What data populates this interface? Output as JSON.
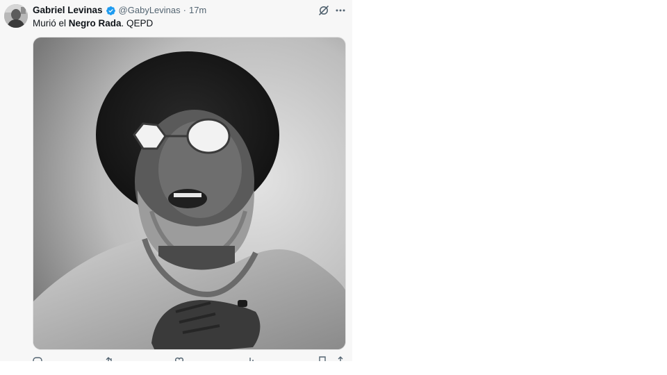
{
  "tweet": {
    "author": {
      "display_name": "Gabriel Levinas",
      "handle": "@GabyLevinas",
      "verified": true
    },
    "separator": "·",
    "time_ago": "17m",
    "text_parts": {
      "before": "Murió el ",
      "bold": "Negro Rada",
      "after": ". QEPD"
    },
    "media": {
      "type": "photo",
      "style": "black-and-white portrait"
    }
  },
  "icons": {
    "verified": "verified-badge-icon",
    "grok": "grok-icon",
    "more": "more-options-icon",
    "reply": "reply-icon",
    "repost": "repost-icon",
    "like": "like-icon",
    "views": "views-icon",
    "bookmark": "bookmark-icon",
    "share": "share-icon"
  },
  "colors": {
    "card_background": "#f7f7f7",
    "page_background": "#ffffff",
    "text_primary": "#0f1419",
    "text_secondary": "#536471",
    "verified_blue": "#1d9bf0"
  }
}
